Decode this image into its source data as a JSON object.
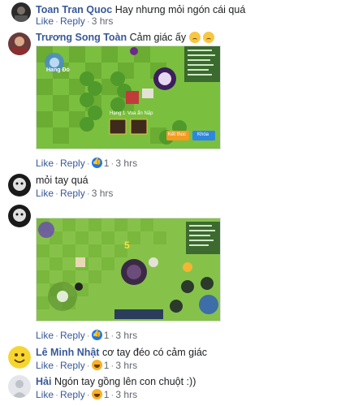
{
  "actions": {
    "like": "Like",
    "reply": "Reply"
  },
  "comments": [
    {
      "name": "Toan Tran Quoc",
      "text": "Hay nhưng mỏi ngón cái quá",
      "time": "3 hrs",
      "reactions": ""
    },
    {
      "name": "Trương Song Toàn",
      "text": "Cảm giác ấy",
      "time": "3 hrs",
      "reactions": "1"
    },
    {
      "name": "",
      "text": "mỏi tay quá",
      "time": "3 hrs",
      "reactions": ""
    },
    {
      "name": "",
      "text": "",
      "time": "3 hrs",
      "reactions": "1"
    },
    {
      "name": "Lê Minh Nhật",
      "text": "cơ tay đéo có cảm giác",
      "time": "3 hrs",
      "reactions": "1"
    },
    {
      "name": "Hải",
      "text": "Ngón tay gồng lên con chuột :))",
      "time": "3 hrs",
      "reactions": "1"
    }
  ],
  "game1": {
    "label_left": "Hang Đỏ",
    "plate_a": "Hạng 1",
    "plate_b": "Vua ẩn Nấp",
    "btn_exit": "Kết thúc",
    "btn_continue": "Khóa"
  },
  "game2": {
    "counter": "5"
  },
  "colors": {
    "link": "#385898",
    "grass": "#7bbf3f",
    "grass_dark": "#6aad32"
  }
}
